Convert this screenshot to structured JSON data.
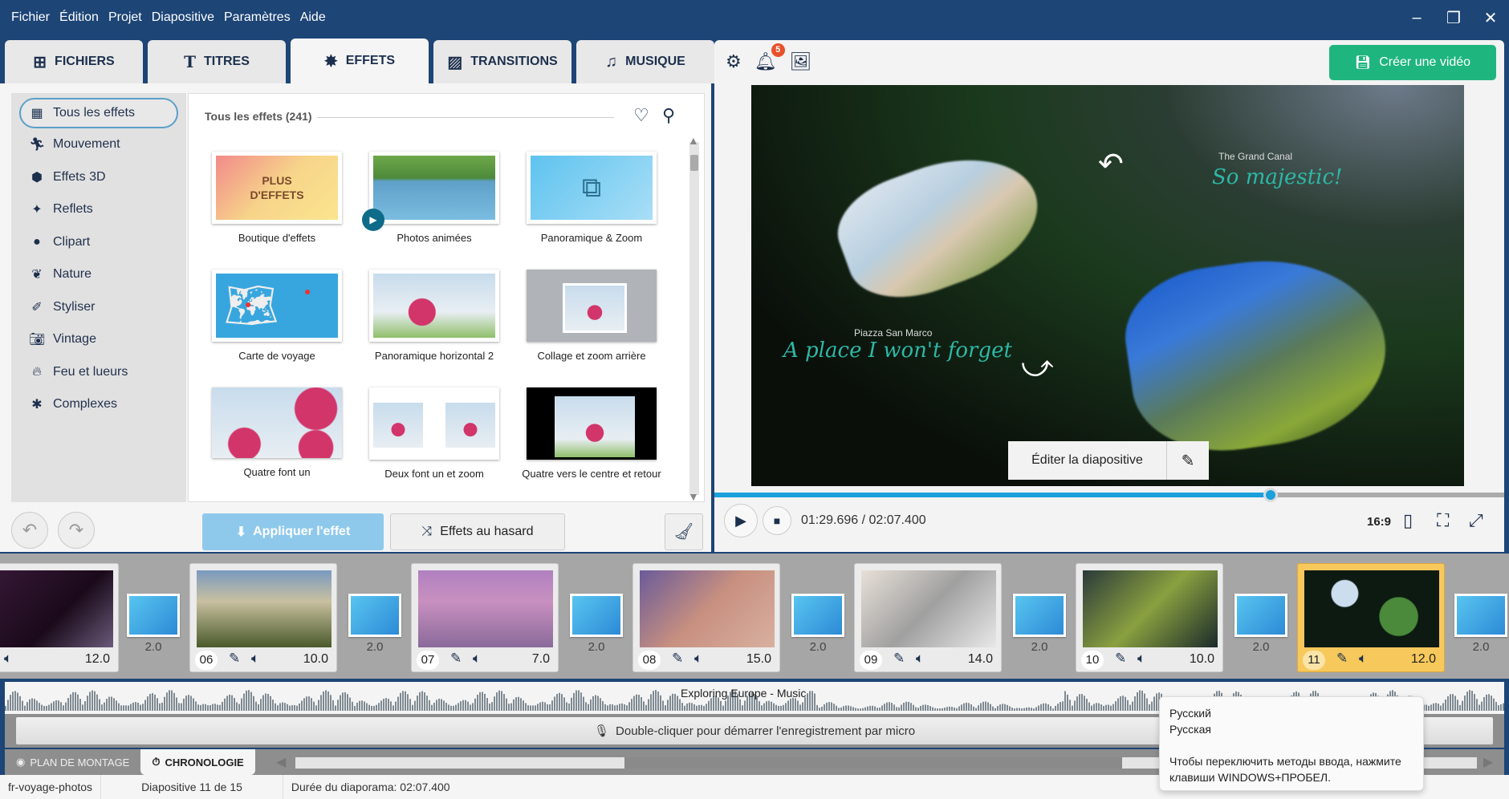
{
  "menu": [
    "Fichier",
    "Édition",
    "Projet",
    "Diapositive",
    "Paramètres",
    "Aide"
  ],
  "window_controls": {
    "minimize": "–",
    "restore": "❐",
    "close": "✕"
  },
  "tabs": [
    {
      "label": "FICHIERS",
      "icon": "add-media-icon"
    },
    {
      "label": "TITRES",
      "icon": "text-icon"
    },
    {
      "label": "EFFETS",
      "icon": "effects-star-icon",
      "active": true
    },
    {
      "label": "TRANSITIONS",
      "icon": "transitions-icon"
    },
    {
      "label": "MUSIQUE",
      "icon": "music-note-icon"
    }
  ],
  "toolbar": {
    "notification_count": "5",
    "create_video_label": "Créer une vidéo"
  },
  "categories": [
    {
      "label": "Tous les effets",
      "icon": "grid-icon",
      "active": true
    },
    {
      "label": "Mouvement",
      "icon": "running-icon"
    },
    {
      "label": "Effets 3D",
      "icon": "cube-icon"
    },
    {
      "label": "Reflets",
      "icon": "sparkle-icon"
    },
    {
      "label": "Clipart",
      "icon": "balloon-icon"
    },
    {
      "label": "Nature",
      "icon": "leaf-icon"
    },
    {
      "label": "Styliser",
      "icon": "brush-icon"
    },
    {
      "label": "Vintage",
      "icon": "camera-icon"
    },
    {
      "label": "Feu et lueurs",
      "icon": "flame-icon"
    },
    {
      "label": "Complexes",
      "icon": "puzzle-icon"
    }
  ],
  "effects_header": "Tous les effets (241)",
  "effects": [
    {
      "label": "Boutique d'effets",
      "thumb_text": "PLUS D'EFFETS"
    },
    {
      "label": "Photos animées"
    },
    {
      "label": "Panoramique & Zoom"
    },
    {
      "label": "Carte de voyage"
    },
    {
      "label": "Panoramique horizontal 2"
    },
    {
      "label": "Collage et zoom arrière"
    },
    {
      "label": "Quatre font un"
    },
    {
      "label": "Deux font un et zoom"
    },
    {
      "label": "Quatre vers le centre et retour"
    }
  ],
  "effects_actions": {
    "apply_label": "Appliquer l'effet",
    "random_label": "Effets au hasard"
  },
  "preview": {
    "text_grand_canal": "The Grand Canal",
    "text_majestic": "So majestic!",
    "text_piazza": "Piazza San Marco",
    "text_place": "A place I won't forget",
    "edit_slide_label": "Éditer la diapositive",
    "timecode": "01:29.696 / 02:07.400",
    "progress_fraction": 0.704,
    "aspect_ratio": "16:9"
  },
  "slides": [
    {
      "num": "",
      "duration": "12.0"
    },
    {
      "num": "06",
      "duration": "10.0"
    },
    {
      "num": "07",
      "duration": "7.0"
    },
    {
      "num": "08",
      "duration": "15.0"
    },
    {
      "num": "09",
      "duration": "14.0"
    },
    {
      "num": "10",
      "duration": "10.0"
    },
    {
      "num": "11",
      "duration": "12.0",
      "selected": true
    }
  ],
  "transitions": [
    "2.0",
    "2.0",
    "2.0",
    "2.0",
    "2.0",
    "2.0",
    "2.0"
  ],
  "audio": {
    "track_name": "Exploring Europe - Music"
  },
  "mic_hint": "Double-cliquer pour démarrer l'enregistrement par micro",
  "bottom_tabs": [
    {
      "label": "PLAN DE MONTAGE"
    },
    {
      "label": "CHRONOLOGIE",
      "active": true
    }
  ],
  "status": {
    "project": "fr-voyage-photos",
    "slide": "Diapositive 11 de 15",
    "duration": "Durée du diaporama: 02:07.400"
  },
  "tooltip": {
    "line1": "Русский",
    "line2": "Русская",
    "line3": "Чтобы переключить методы ввода, нажмите клавиши WINDOWS+ПРОБЕЛ."
  }
}
